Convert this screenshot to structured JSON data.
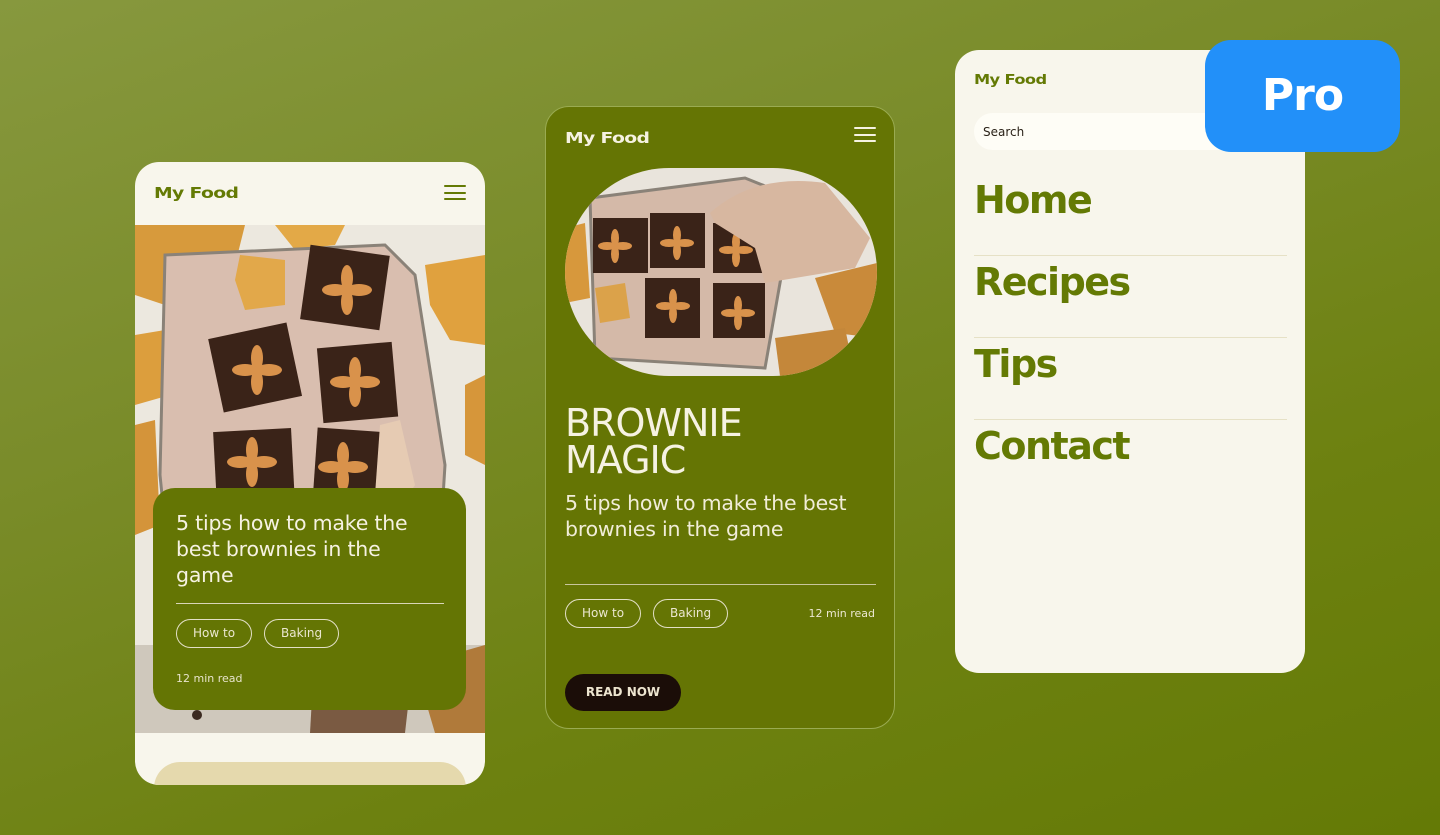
{
  "colors": {
    "brand_green": "#647504",
    "cream": "#f8f6ec",
    "pro_blue": "#2290f9",
    "button_dark": "#1b0d08"
  },
  "phone1": {
    "logo": "My Food",
    "card": {
      "title": "5 tips how to make the best brownies in the game",
      "tags": [
        "How to",
        "Baking"
      ],
      "read_time": "12 min read"
    }
  },
  "phone2": {
    "logo": "My Food",
    "headline_line1": "BROWNIE",
    "headline_line2": "MAGIC",
    "subtitle": "5 tips how to make the best brownies in the game",
    "tags": [
      "How to",
      "Baking"
    ],
    "read_time": "12 min read",
    "cta_label": "READ NOW"
  },
  "phone3": {
    "logo": "My Food",
    "search_placeholder": "Search",
    "nav_items": [
      "Home",
      "Recipes",
      "Tips",
      "Contact"
    ]
  },
  "badge": {
    "label": "Pro"
  },
  "icons": {
    "menu": "hamburger-menu-icon",
    "image": "brownies-photo"
  }
}
